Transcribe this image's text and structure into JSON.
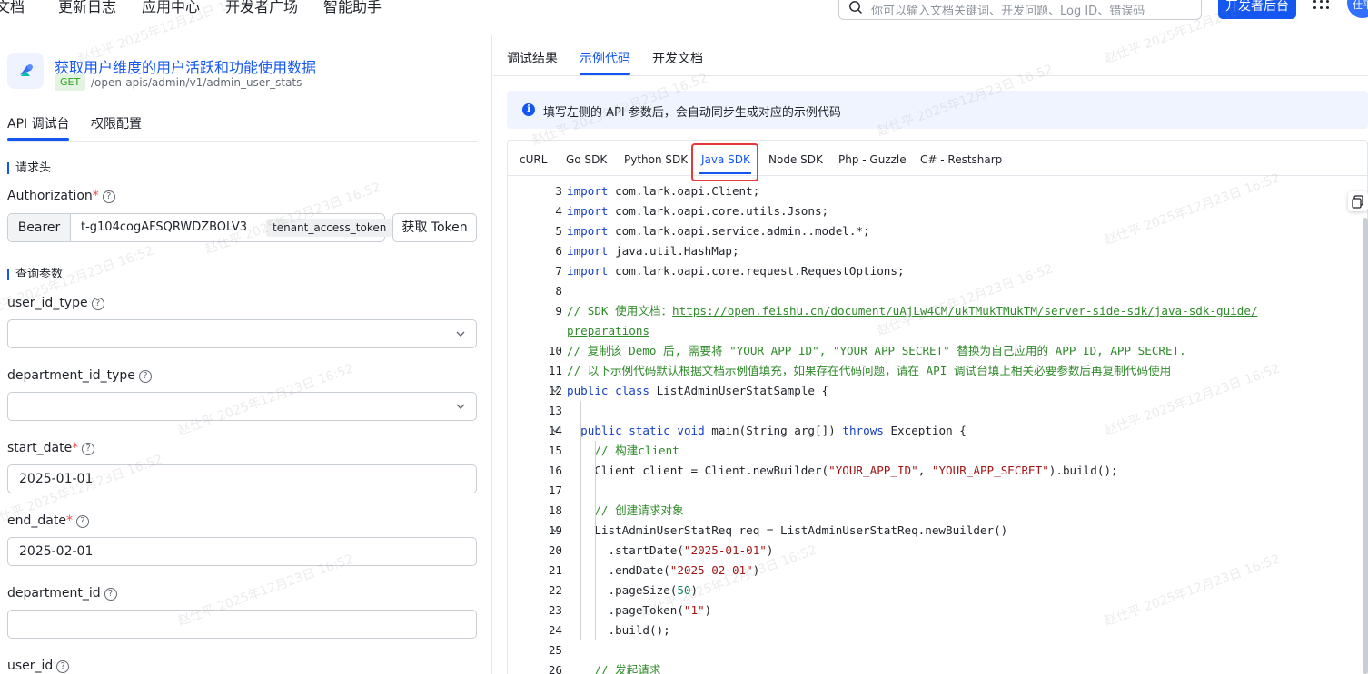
{
  "topnav": {
    "items": [
      "文档",
      "更新日志",
      "应用中心",
      "开发者广场",
      "智能助手"
    ],
    "search_placeholder": "你可以输入文档关键词、开发问题、Log ID、错误码",
    "dev_console_label": "开发者后台",
    "avatar_text": "仕平"
  },
  "api": {
    "title": "获取用户维度的用户活跃和功能使用数据",
    "method": "GET",
    "path": "/open-apis/admin/v1/admin_user_stats"
  },
  "left_tabs": [
    "API 调试台",
    "权限配置"
  ],
  "request_header": {
    "section_title": "请求头",
    "auth_label": "Authorization",
    "auth_prefix": "Bearer",
    "token_value": "t-g104cogAFSQRWDZBOLV3",
    "token_type": "tenant_access_token",
    "get_token_label": "获取 Token"
  },
  "query_params": {
    "section_title": "查询参数",
    "fields": [
      {
        "label": "user_id_type",
        "required": false,
        "value": ""
      },
      {
        "label": "department_id_type",
        "required": false,
        "value": ""
      },
      {
        "label": "start_date",
        "required": true,
        "value": "2025-01-01"
      },
      {
        "label": "end_date",
        "required": true,
        "value": "2025-02-01"
      },
      {
        "label": "department_id",
        "required": false,
        "value": ""
      },
      {
        "label": "user_id",
        "required": false,
        "value": ""
      }
    ]
  },
  "right_tabs": [
    "调试结果",
    "示例代码",
    "开发文档"
  ],
  "info_banner": "填写左侧的 API 参数后，会自动同步生成对应的示例代码",
  "sdk_tabs": [
    "cURL",
    "Go SDK",
    "Python SDK",
    "Java SDK",
    "Node SDK",
    "Php - Guzzle",
    "C# - Restsharp"
  ],
  "selected_sdk": "Java SDK",
  "code_lines": [
    {
      "n": "3",
      "text": "import com.lark.oapi.Client;"
    },
    {
      "n": "4",
      "text": "import com.lark.oapi.core.utils.Jsons;"
    },
    {
      "n": "5",
      "text": "import com.lark.oapi.service.admin.v1.model.*;"
    },
    {
      "n": "6",
      "text": "import java.util.HashMap;"
    },
    {
      "n": "7",
      "text": "import com.lark.oapi.core.request.RequestOptions;"
    },
    {
      "n": "8",
      "text": ""
    },
    {
      "n": "9",
      "text": "// SDK 使用文档：https://open.feishu.cn/document/uAjLw4CM/ukTMukTMukTM/server-side-sdk/java-sdk-guide/preparations"
    },
    {
      "n": "10",
      "text": "// 复制该 Demo 后, 需要将 \"YOUR_APP_ID\", \"YOUR_APP_SECRET\" 替换为自己应用的 APP_ID, APP_SECRET."
    },
    {
      "n": "11",
      "text": "// 以下示例代码默认根据文档示例值填充，如果存在代码问题，请在 API 调试台填上相关必要参数后再复制代码使用"
    },
    {
      "n": "12",
      "text": "public class ListAdminUserStatSample {"
    },
    {
      "n": "13",
      "text": ""
    },
    {
      "n": "14",
      "text": "  public static void main(String arg[]) throws Exception {"
    },
    {
      "n": "15",
      "text": "    // 构建client"
    },
    {
      "n": "16",
      "text": "    Client client = Client.newBuilder(\"YOUR_APP_ID\", \"YOUR_APP_SECRET\").build();"
    },
    {
      "n": "17",
      "text": ""
    },
    {
      "n": "18",
      "text": "    // 创建请求对象"
    },
    {
      "n": "19",
      "text": "    ListAdminUserStatReq req = ListAdminUserStatReq.newBuilder()"
    },
    {
      "n": "20",
      "text": "      .startDate(\"2025-01-01\")"
    },
    {
      "n": "21",
      "text": "      .endDate(\"2025-02-01\")"
    },
    {
      "n": "22",
      "text": "      .pageSize(50)"
    },
    {
      "n": "23",
      "text": "      .pageToken(\"1\")"
    },
    {
      "n": "24",
      "text": "      .build();"
    },
    {
      "n": "25",
      "text": ""
    },
    {
      "n": "26",
      "text": "    // 发起请求"
    }
  ],
  "watermark": "赵仕平 2025年12月23日 16:52",
  "colors": {
    "accent": "#1456f0",
    "highlight_border": "#e5383b",
    "required": "#f54a45"
  }
}
